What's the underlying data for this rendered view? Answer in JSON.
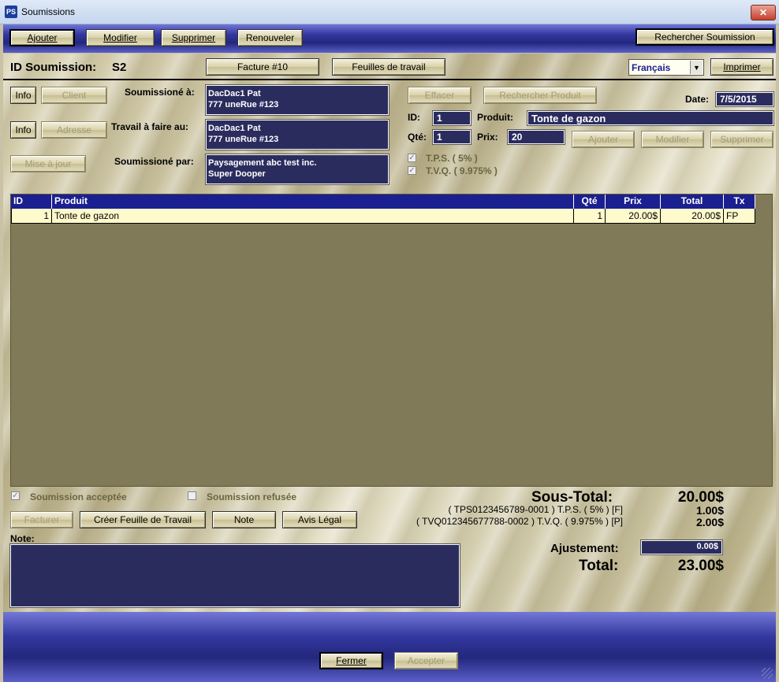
{
  "window": {
    "title": "Soumissions",
    "app_icon": "PS",
    "close_icon": "close-icon"
  },
  "toolbar": {
    "ajouter": "Ajouter",
    "modifier": "Modifier",
    "supprimer": "Supprimer",
    "renouveler": "Renouveler",
    "rechercher": "Rechercher Soumission"
  },
  "header": {
    "id_label": "ID Soumission:",
    "id_value": "S2",
    "facture": "Facture #10",
    "feuilles": "Feuilles de travail",
    "language": "Français",
    "imprimer": "Imprimer"
  },
  "client": {
    "info1": "Info",
    "client_btn": "Client",
    "info2": "Info",
    "adresse_btn": "Adresse",
    "mise_a_jour": "Mise à jour",
    "soumissione_a_label": "Soumissioné à:",
    "soumissione_a_line1": "DacDac1 Pat",
    "soumissione_a_line2": "777 uneRue #123",
    "travail_label": "Travail à faire au:",
    "travail_line1": "DacDac1 Pat",
    "travail_line2": "777 uneRue #123",
    "par_label": "Soumissioné par:",
    "par_line1": "Paysagement abc test inc.",
    "par_line2": "Super Dooper"
  },
  "product": {
    "effacer": "Effacer",
    "rechercher_produit": "Rechercher Produit",
    "date_label": "Date:",
    "date_value": "7/5/2015",
    "id_label": "ID:",
    "id_value": "1",
    "produit_label": "Produit:",
    "produit_value": "Tonte de gazon",
    "qte_label": "Qté:",
    "qte_value": "1",
    "prix_label": "Prix:",
    "prix_value": "20",
    "ajouter": "Ajouter",
    "modifier": "Modifier",
    "supprimer": "Supprimer",
    "tps_label": "T.P.S.  ( 5% )",
    "tvq_label": "T.V.Q.  ( 9.975% )"
  },
  "grid": {
    "columns": [
      "ID",
      "Produit",
      "Qté",
      "Prix",
      "Total",
      "Tx"
    ],
    "rows": [
      {
        "id": "1",
        "produit": "Tonte de gazon",
        "qte": "1",
        "prix": "20.00$",
        "total": "20.00$",
        "tx": "FP"
      }
    ]
  },
  "status": {
    "acceptee": "Soumission acceptée",
    "refusee": "Soumission refusée"
  },
  "actions": {
    "facturer": "Facturer",
    "creer_feuille": "Créer Feuille de Travail",
    "note": "Note",
    "avis_legal": "Avis Légal",
    "note_label": "Note:"
  },
  "totals": {
    "sous_total_label": "Sous-Total:",
    "sous_total_value": "20.00$",
    "tps_line": "( TPS0123456789-0001 )  T.P.S.  ( 5% ) [F]",
    "tps_value": "1.00$",
    "tvq_line": "( TVQ012345677788-0002 )  T.V.Q.  ( 9.975% ) [P]",
    "tvq_value": "2.00$",
    "ajustement_label": "Ajustement:",
    "ajustement_value": "0.00$",
    "total_label": "Total:",
    "total_value": "23.00$"
  },
  "footer": {
    "fermer": "Fermer",
    "accepter": "Accepter"
  }
}
